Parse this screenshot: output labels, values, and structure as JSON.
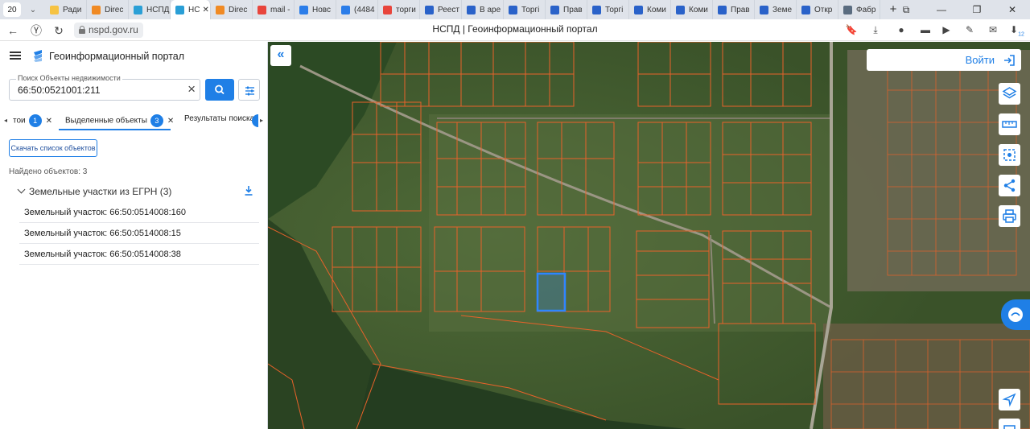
{
  "browser": {
    "tab_count": "20",
    "tabs": [
      {
        "label": "Ради",
        "color": "#f6c343"
      },
      {
        "label": "Direc",
        "color": "#f08a24"
      },
      {
        "label": "НСПД",
        "color": "#2a9fd6"
      },
      {
        "label": "НС",
        "color": "#2a9fd6",
        "active": true
      },
      {
        "label": "Direc",
        "color": "#f08a24"
      },
      {
        "label": "mail -",
        "color": "#e8453c"
      },
      {
        "label": "Новс",
        "color": "#2b7de9"
      },
      {
        "label": "(4484",
        "color": "#2b7de9"
      },
      {
        "label": "торги",
        "color": "#e8453c"
      },
      {
        "label": "Реест",
        "color": "#2a62c9"
      },
      {
        "label": "В аре",
        "color": "#2a62c9"
      },
      {
        "label": "Торгі",
        "color": "#2a62c9"
      },
      {
        "label": "Прав",
        "color": "#2a62c9"
      },
      {
        "label": "Торгі",
        "color": "#2a62c9"
      },
      {
        "label": "Коми",
        "color": "#2a62c9"
      },
      {
        "label": "Коми",
        "color": "#2a62c9"
      },
      {
        "label": "Прав",
        "color": "#2a62c9"
      },
      {
        "label": "Земе",
        "color": "#2a62c9"
      },
      {
        "label": "Откр",
        "color": "#2a62c9"
      },
      {
        "label": "Фабр",
        "color": "#5a6c80"
      }
    ],
    "url": "nspd.gov.ru",
    "page_title": "НСПД | Геоинформационный портал",
    "ext_badge": "12"
  },
  "sidebar": {
    "portal_title": "Геоинформационный портал",
    "search": {
      "label": "Поиск Объекты недвижимости",
      "value": "66:50:0521001:211"
    },
    "tabs": {
      "first_label": "тои",
      "first_count": "1",
      "selected_label": "Выделенные объекты",
      "selected_count": "3",
      "results_label": "Результаты поиска"
    },
    "download_list_label": "Скачать список объектов",
    "found_text": "Найдено объектов: 3",
    "group_title": "Земельные участки из ЕГРН (3)",
    "items": [
      "Земельный участок: 66:50:0514008:160",
      "Земельный участок: 66:50:0514008:15",
      "Земельный участок: 66:50:0514008:38"
    ]
  },
  "map": {
    "login_label": "Войти",
    "parcel_color": "#e8622a",
    "selected_color": "#2e86ff"
  }
}
